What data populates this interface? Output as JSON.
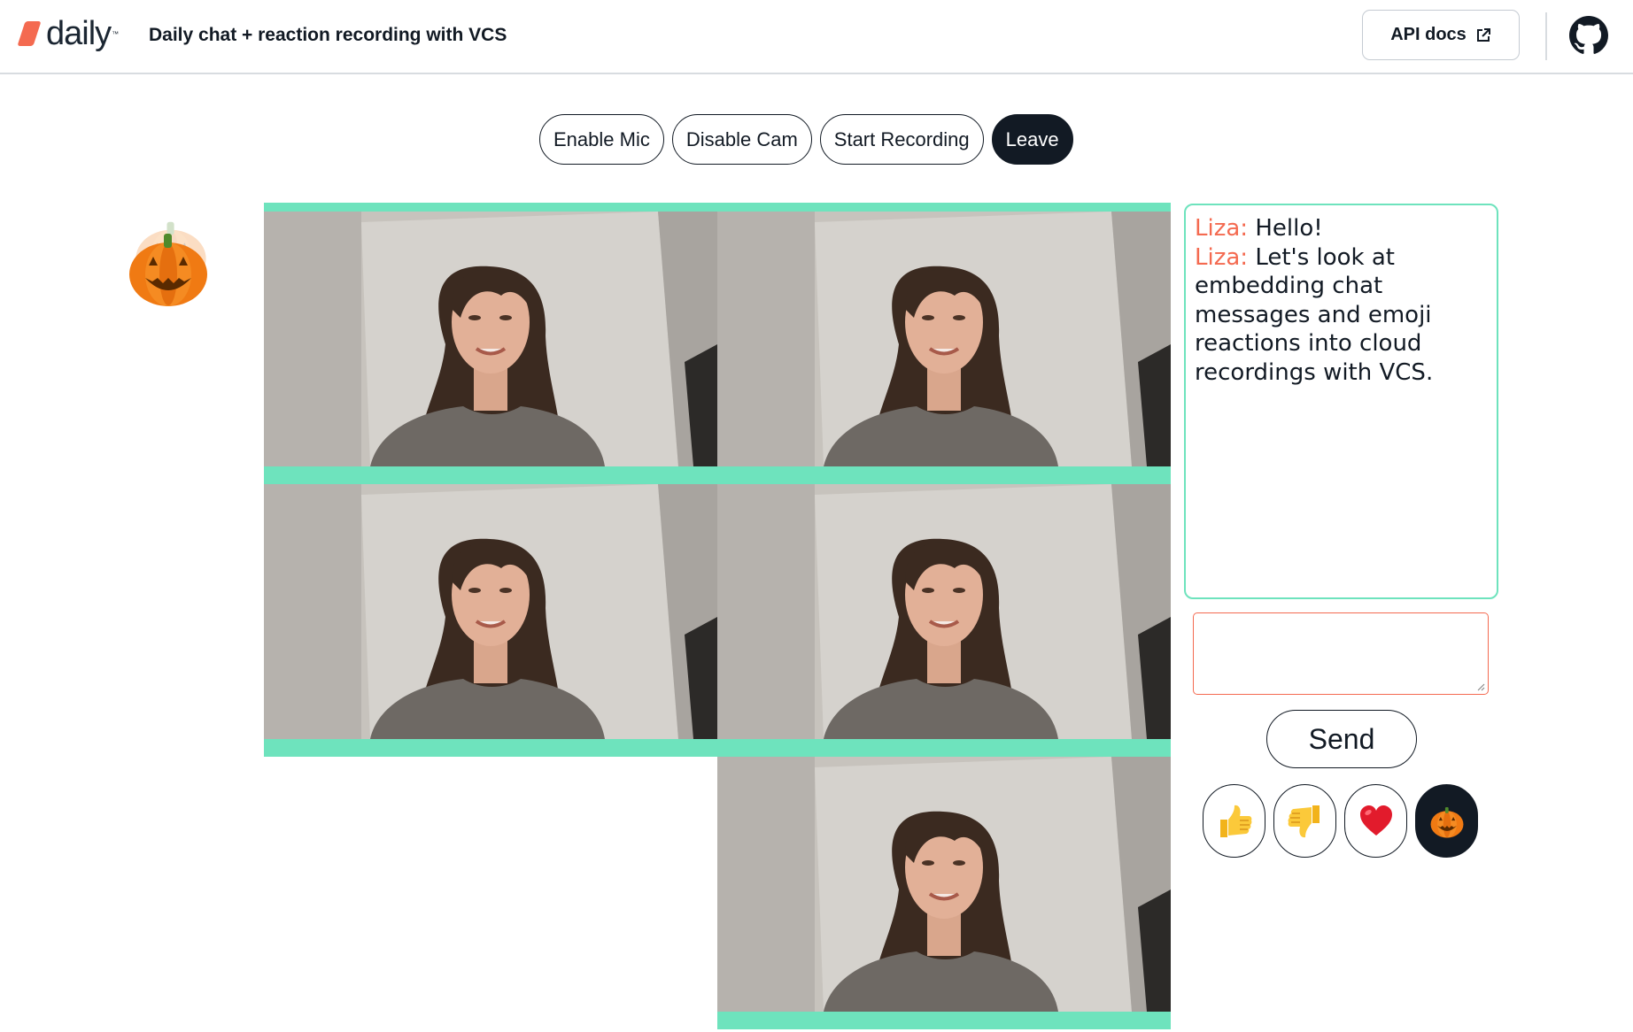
{
  "header": {
    "logo_text": "daily",
    "logo_tm": "™",
    "title": "Daily chat + reaction recording with VCS",
    "api_docs_label": "API docs",
    "icons": {
      "external": "external-link-icon",
      "github": "github-icon"
    }
  },
  "controls": {
    "enable_mic": "Enable Mic",
    "disable_cam": "Disable Cam",
    "start_recording": "Start Recording",
    "leave": "Leave"
  },
  "reaction_display": {
    "emoji": "pumpkin"
  },
  "video": {
    "tile_count": 5,
    "accent_color": "#6ee3bd"
  },
  "chat": {
    "messages": [
      {
        "name": "Liza:",
        "text": "Hello!"
      },
      {
        "name": "Liza:",
        "text": "Let's look at embedding chat messages and emoji reactions into cloud recordings with VCS."
      }
    ],
    "input_value": "",
    "send_label": "Send",
    "name_color": "#f46a50",
    "border_color": "#6ee3bd"
  },
  "reactions": {
    "buttons": [
      {
        "name": "thumbs-up",
        "selected": false
      },
      {
        "name": "thumbs-down",
        "selected": false
      },
      {
        "name": "heart",
        "selected": false
      },
      {
        "name": "pumpkin",
        "selected": true
      }
    ]
  }
}
